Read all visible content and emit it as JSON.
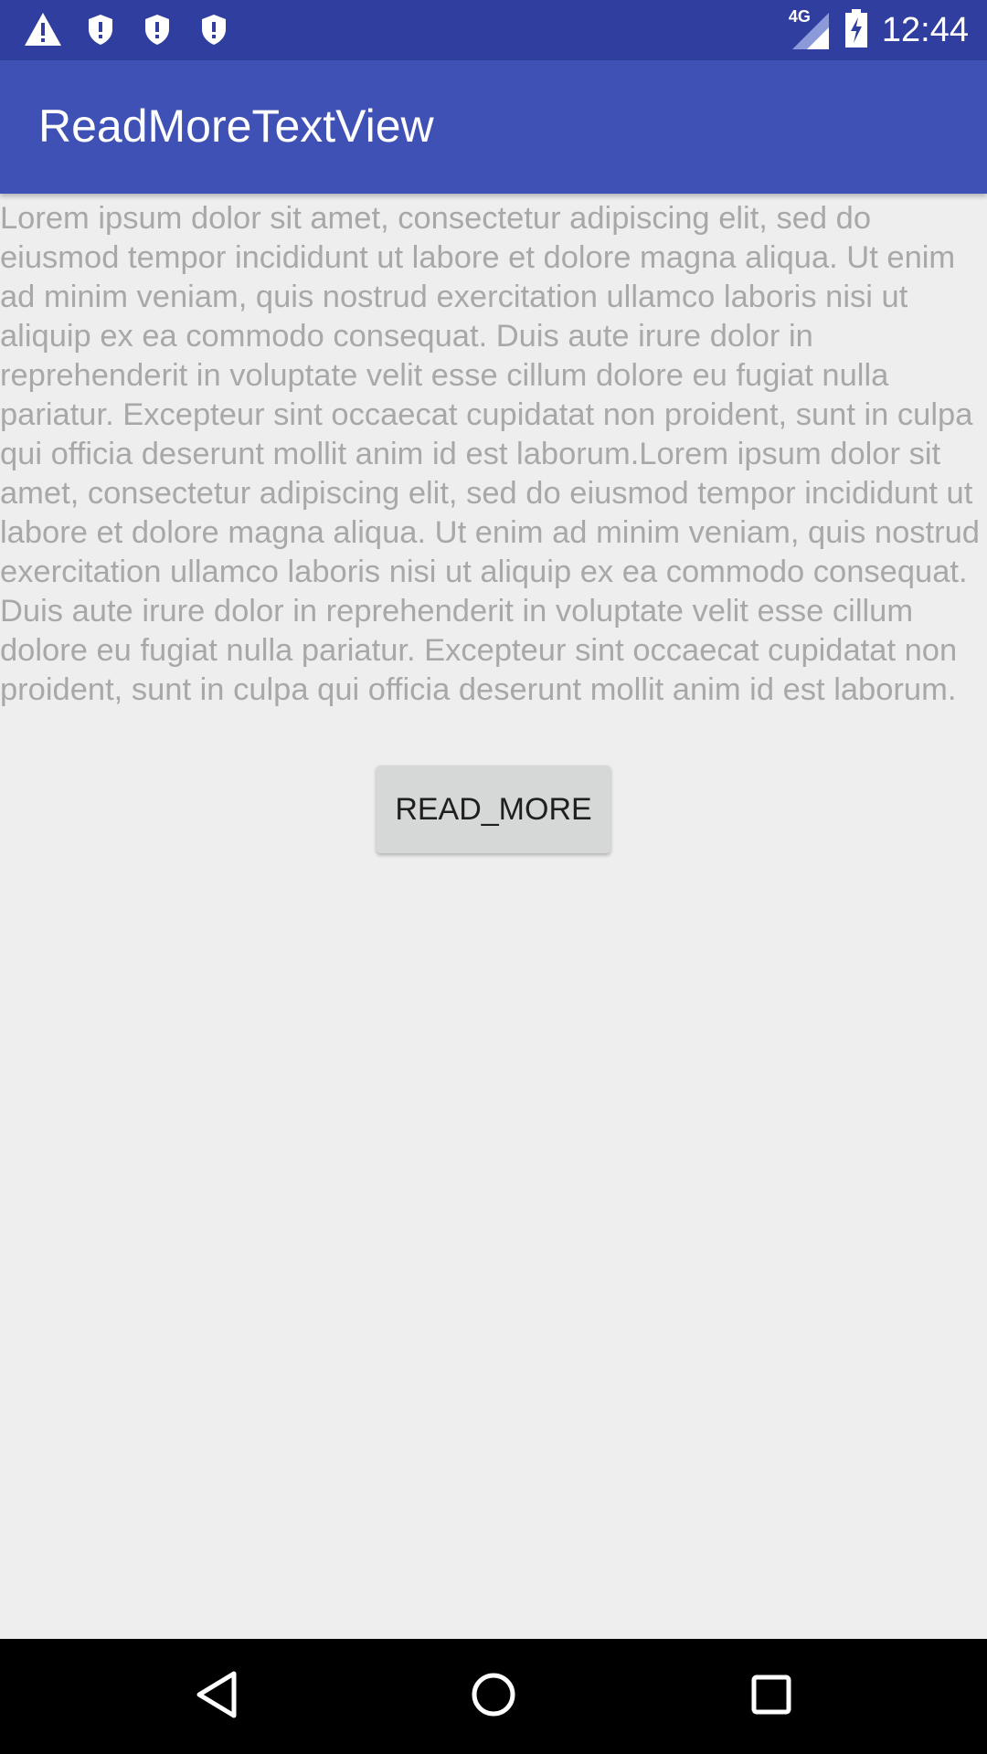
{
  "status_bar": {
    "time": "12:44",
    "network": "4G",
    "icons": [
      "warning-icon",
      "shield-icon",
      "shield-icon",
      "shield-icon",
      "signal-icon",
      "battery-charging-icon"
    ]
  },
  "app_bar": {
    "title": "ReadMoreTextView"
  },
  "content": {
    "text": "Lorem ipsum dolor sit amet, consectetur adipiscing elit, sed do eiusmod tempor incididunt ut labore et dolore magna aliqua. Ut enim ad minim veniam, quis nostrud exercitation ullamco laboris nisi ut aliquip ex ea commodo consequat. Duis aute irure dolor in reprehenderit in voluptate velit esse cillum dolore eu fugiat nulla pariatur. Excepteur sint occaecat cupidatat non proident, sunt in culpa qui officia deserunt mollit anim id est laborum.Lorem ipsum dolor sit amet, consectetur adipiscing elit, sed do eiusmod tempor incididunt ut labore et dolore magna aliqua. Ut enim ad minim veniam, quis nostrud exercitation ullamco laboris nisi ut aliquip ex ea commodo consequat. Duis aute irure dolor in reprehenderit in voluptate velit esse cillum dolore eu fugiat nulla pariatur. Excepteur sint occaecat cupidatat non proident, sunt in culpa qui officia deserunt mollit anim id est laborum.",
    "button_label": "READ_MORE"
  },
  "nav_bar": {
    "icons": [
      "back-icon",
      "home-icon",
      "recents-icon"
    ]
  },
  "colors": {
    "status_bar": "#303f9f",
    "app_bar": "#3f51b5",
    "background": "#eeeeee",
    "text": "#a8a8a8",
    "button": "#d6d7d7"
  }
}
